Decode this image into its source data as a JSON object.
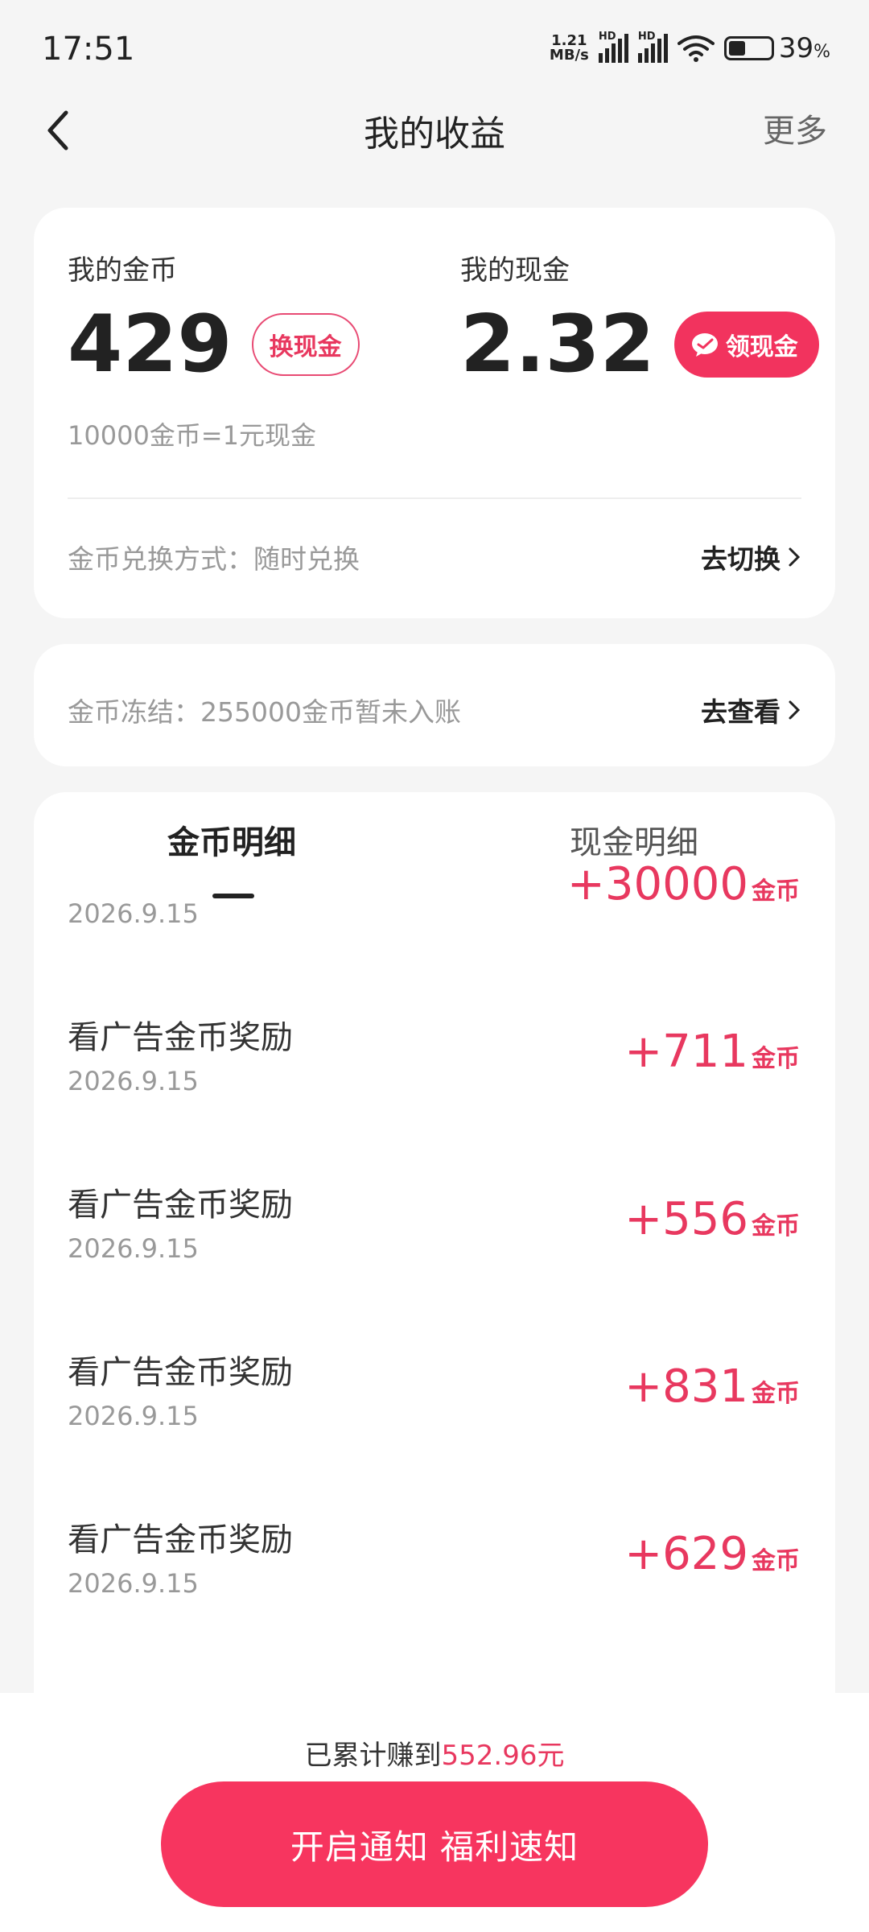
{
  "status_bar": {
    "time": "17:51",
    "net_speed_value": "1.21",
    "net_speed_unit": "MB/s",
    "signal_tag_1": "HD",
    "signal_tag_2": "HD",
    "battery_percent": "39",
    "battery_percent_sign": "%",
    "battery_level": 0.39
  },
  "nav": {
    "title": "我的收益",
    "more": "更多"
  },
  "earnings": {
    "coins_label": "我的金币",
    "coins_value": "429",
    "exchange_button": "换现金",
    "cash_label": "我的现金",
    "cash_value": "2.32",
    "claim_button": "领现金",
    "rate_note": "10000金币=1元现金",
    "exchange_mode_label": "金币兑换方式：随时兑换",
    "exchange_mode_link": "去切换"
  },
  "frozen": {
    "label": "金币冻结：255000金币暂未入账",
    "link": "去查看"
  },
  "detail": {
    "tabs": [
      {
        "label": "金币明细"
      },
      {
        "label": "现金明细"
      }
    ],
    "records": [
      {
        "title": "",
        "date": "2026.9.15",
        "amount": "+30000",
        "unit": "金币"
      },
      {
        "title": "看广告金币奖励",
        "date": "2026.9.15",
        "amount": "+711",
        "unit": "金币"
      },
      {
        "title": "看广告金币奖励",
        "date": "2026.9.15",
        "amount": "+556",
        "unit": "金币"
      },
      {
        "title": "看广告金币奖励",
        "date": "2026.9.15",
        "amount": "+831",
        "unit": "金币"
      },
      {
        "title": "看广告金币奖励",
        "date": "2026.9.15",
        "amount": "+629",
        "unit": "金币"
      }
    ]
  },
  "footer": {
    "total_prefix": "已累计赚到",
    "total_value": "552.96元",
    "cta": "开启通知 福利速知"
  },
  "colors": {
    "accent": "#f2335e",
    "background": "#f5f5f5"
  }
}
